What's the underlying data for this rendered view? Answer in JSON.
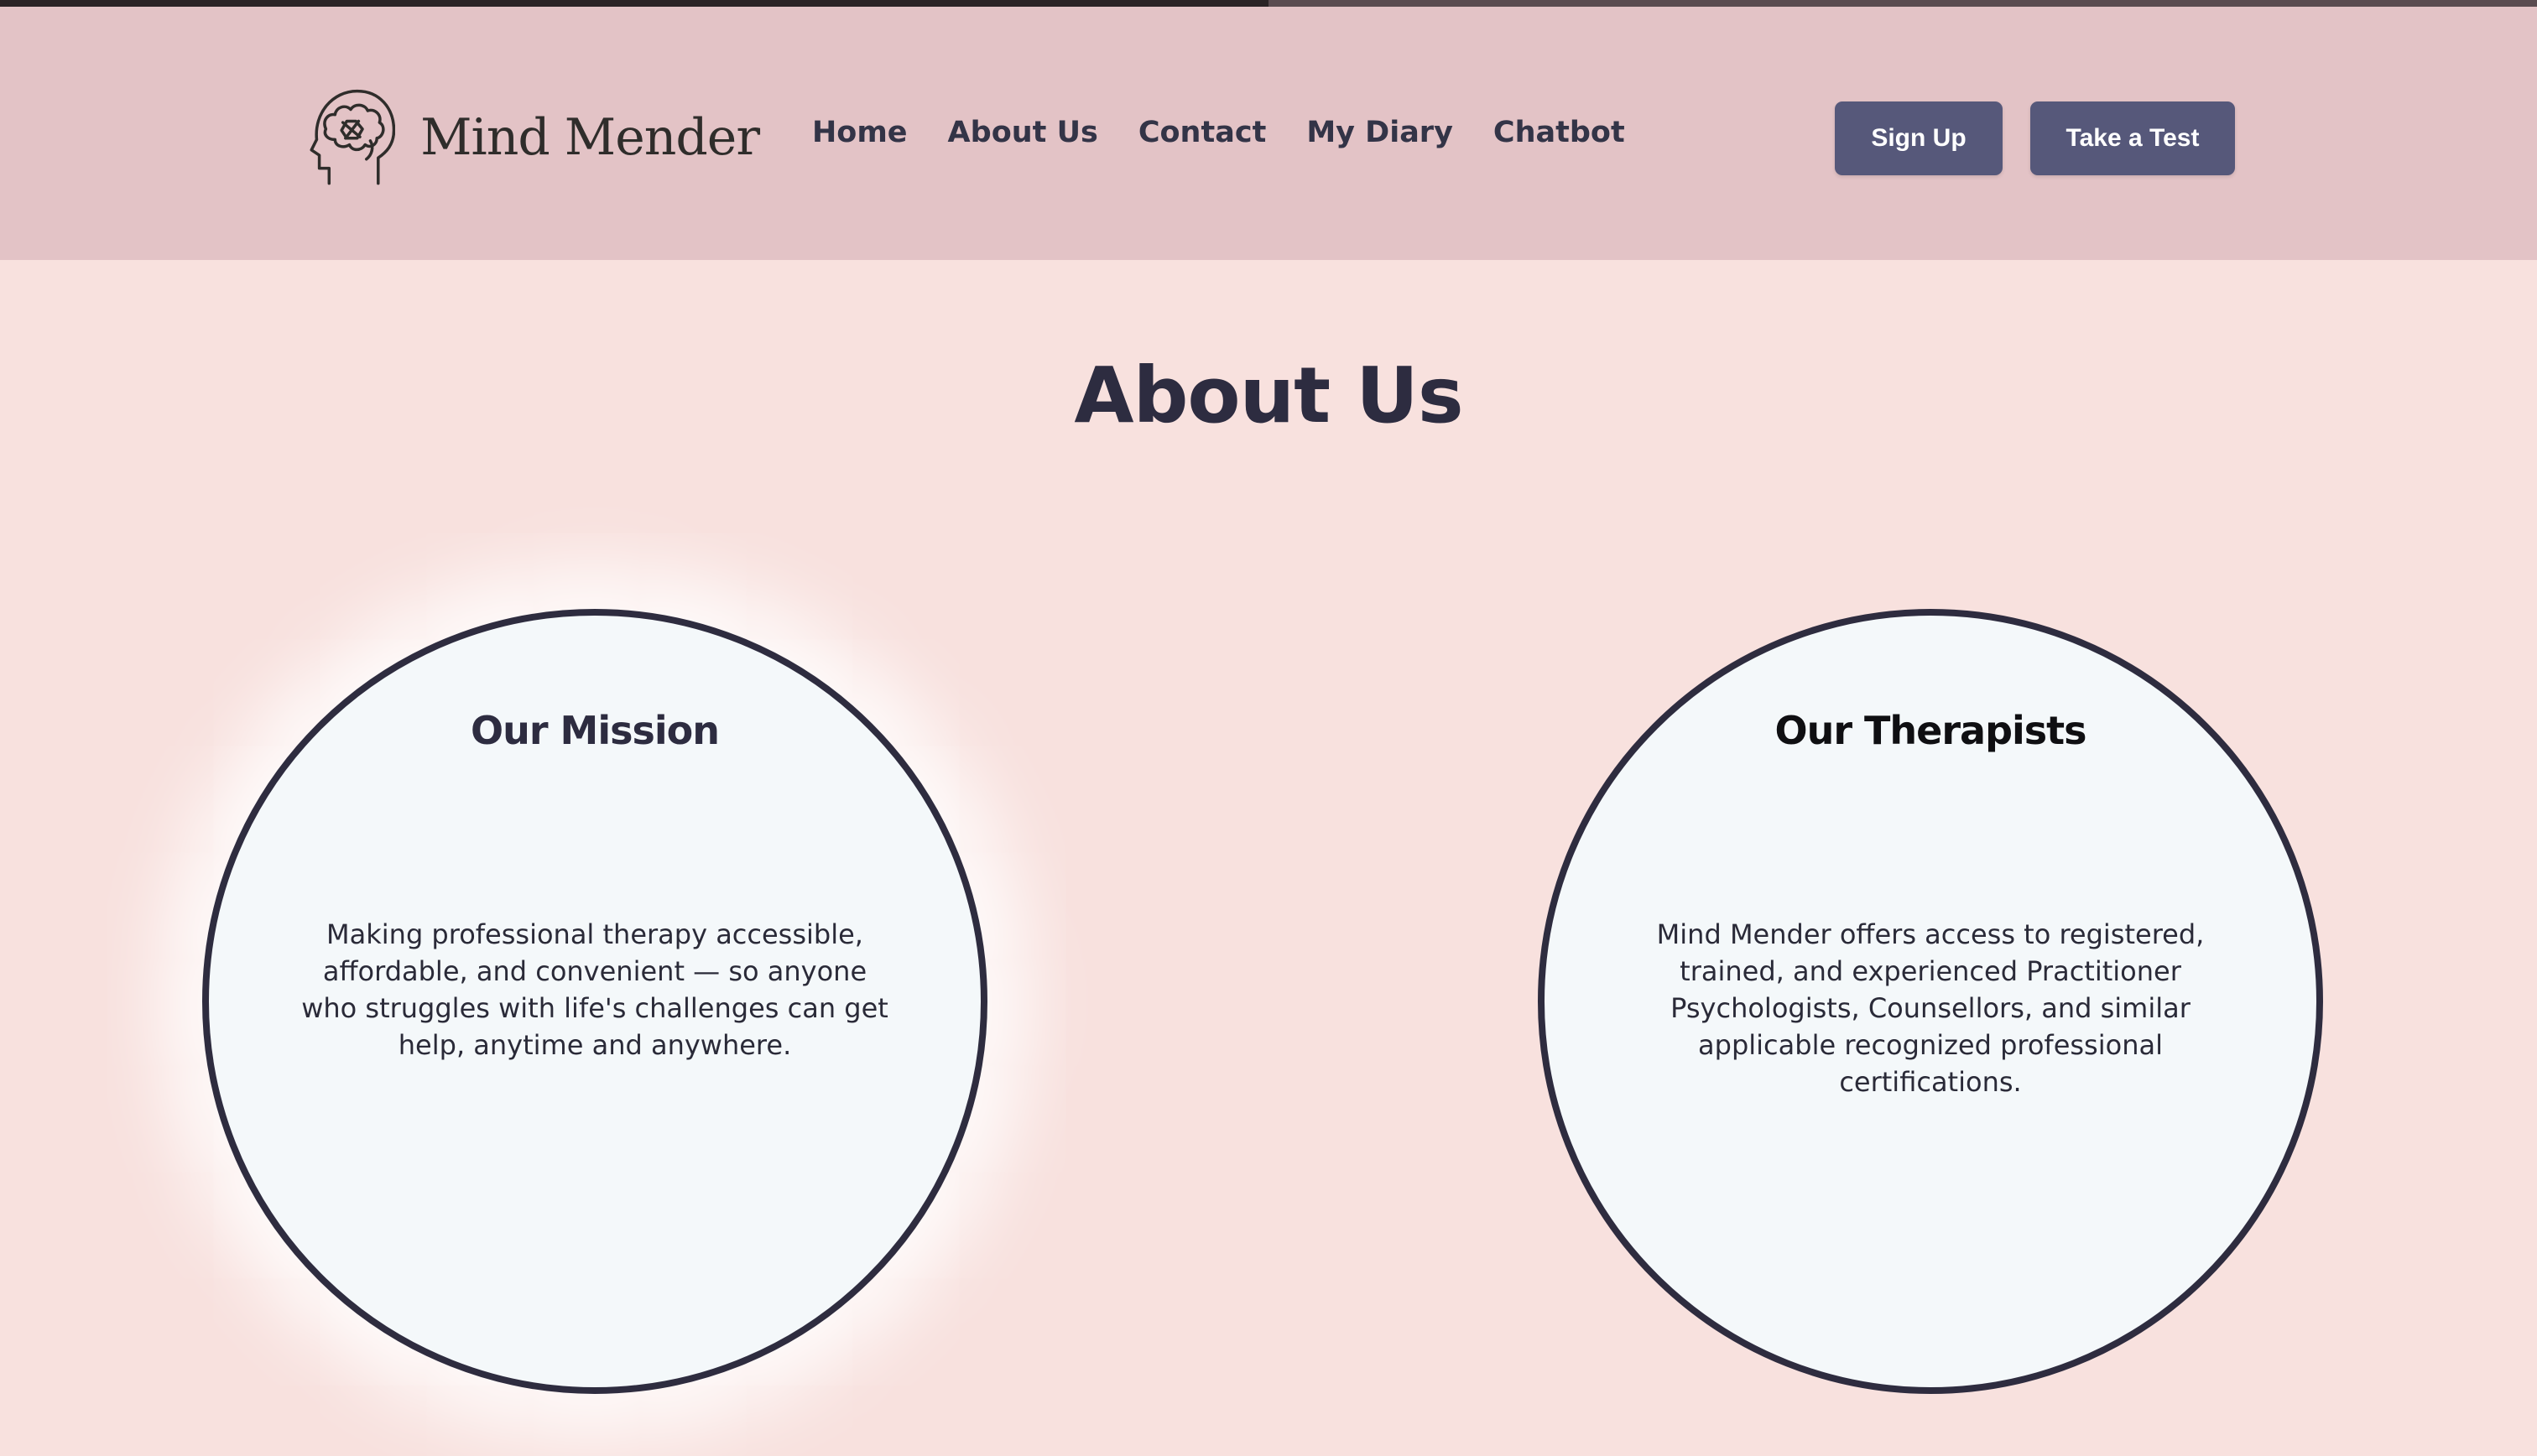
{
  "header": {
    "logo_text": "Mind Mender",
    "logo_icon": "brain-head-bandage-icon",
    "nav": {
      "home": "Home",
      "about": "About Us",
      "contact": "Contact",
      "diary": "My Diary",
      "chatbot": "Chatbot"
    },
    "signup_label": "Sign Up",
    "test_label": "Take a Test"
  },
  "main": {
    "title": "About Us",
    "mission": {
      "heading": "Our Mission",
      "body": "Making professional therapy accessible, affordable, and convenient — so anyone who struggles with life's challenges can get help, anytime and anywhere."
    },
    "therapists": {
      "heading": "Our Therapists",
      "body": "Mind Mender offers access to registered, trained, and experienced Practitioner Psychologists, Counsellors, and similar applicable recognized professional certifications."
    }
  },
  "colors": {
    "header_bg": "#e3c3c6",
    "page_bg": "#f8e1de",
    "button_bg": "#56587a",
    "text_dark": "#2d2c40",
    "circle_bg": "#f4f8fa"
  }
}
